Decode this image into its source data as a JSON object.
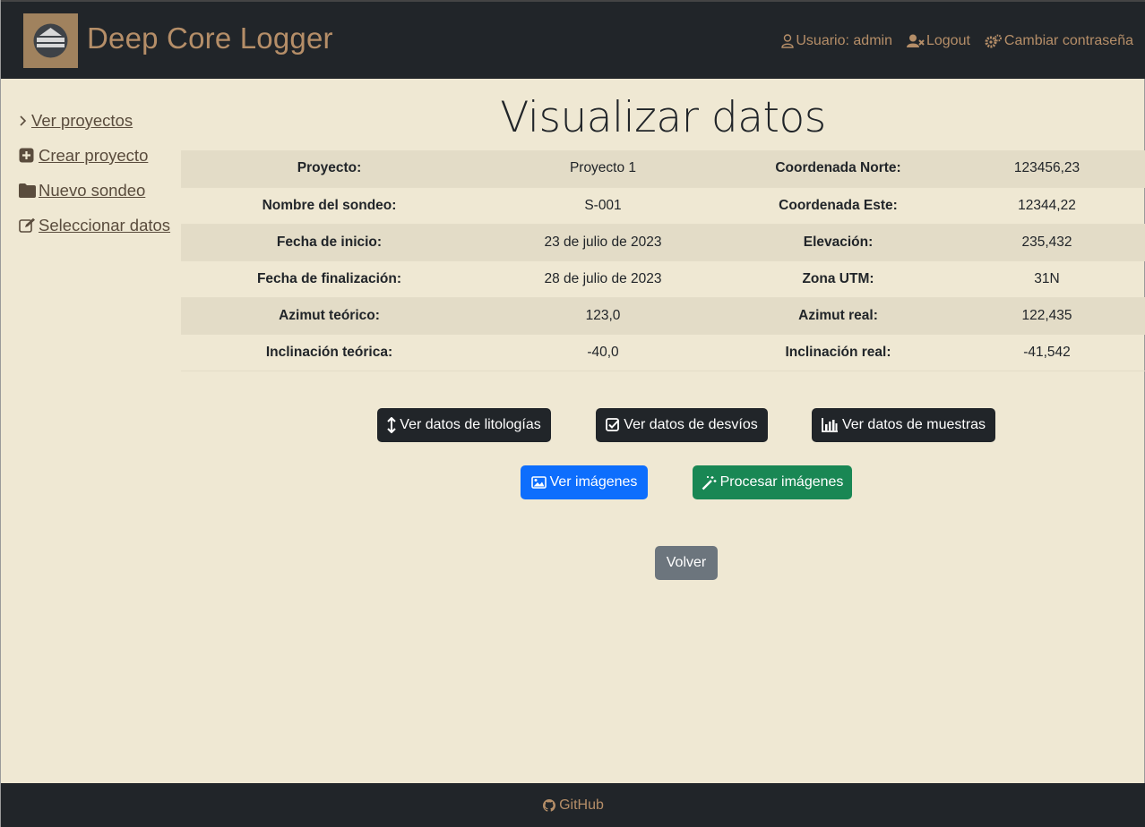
{
  "header": {
    "brand": "Deep Core Logger",
    "user_label": "Usuario: admin",
    "logout_label": "Logout",
    "change_password_label": "Cambiar contraseña"
  },
  "sidebar": {
    "items": [
      {
        "label": " Ver proyectos",
        "icon": "chevron-right-icon"
      },
      {
        "label": " Crear proyecto",
        "icon": "plus-square-icon"
      },
      {
        "label": " Nuevo sondeo",
        "icon": "folder-icon"
      },
      {
        "label": " Seleccionar datos",
        "icon": "edit-icon"
      }
    ]
  },
  "main": {
    "title": "Visualizar datos",
    "rows": [
      {
        "l1": "Proyecto:",
        "v1": "Proyecto 1",
        "l2": "Coordenada Norte:",
        "v2": "123456,23"
      },
      {
        "l1": "Nombre del sondeo:",
        "v1": "S-001",
        "l2": "Coordenada Este:",
        "v2": "12344,22"
      },
      {
        "l1": "Fecha de inicio:",
        "v1": "23 de julio de 2023",
        "l2": "Elevación:",
        "v2": "235,432"
      },
      {
        "l1": "Fecha de finalización:",
        "v1": "28 de julio de 2023",
        "l2": "Zona UTM:",
        "v2": "31N"
      },
      {
        "l1": "Azimut teórico:",
        "v1": "123,0",
        "l2": "Azimut real:",
        "v2": "122,435"
      },
      {
        "l1": "Inclinación teórica:",
        "v1": "-40,0",
        "l2": "Inclinación real:",
        "v2": "-41,542"
      }
    ],
    "buttons": {
      "lithology": "Ver datos de litologías",
      "deviations": "Ver datos de desvíos",
      "samples": "Ver datos de muestras",
      "images": "Ver imágenes",
      "process": "Procesar imágenes",
      "back": "Volver"
    }
  },
  "footer": {
    "github_label": "GitHub"
  },
  "colors": {
    "background": "#efe8d3",
    "header": "#212529",
    "accent": "#b58e68",
    "primary": "#0d6efd",
    "success": "#198754",
    "secondary": "#6c757d"
  }
}
